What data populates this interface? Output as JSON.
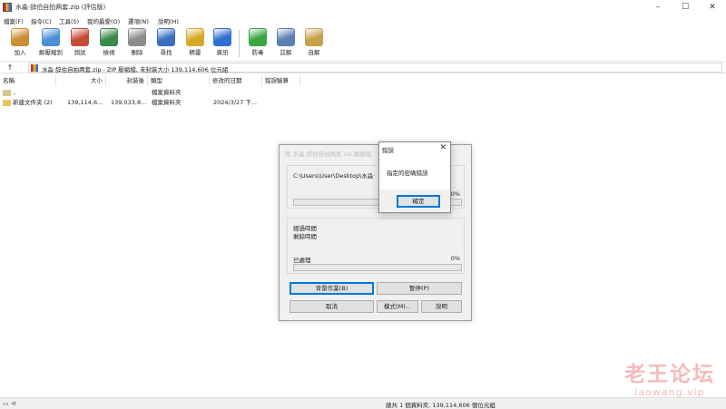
{
  "window": {
    "title": "水淼·辞伯自拍两套.zip (評估版)",
    "minimize": "–",
    "maximize": "☐",
    "close": "✕"
  },
  "menu": [
    "檔案(F)",
    "指令(C)",
    "工具(S)",
    "我的最愛(O)",
    "選項(N)",
    "說明(H)"
  ],
  "toolbar": [
    {
      "label": "加入",
      "icon": "add-archive-icon",
      "color": "#c98d35"
    },
    {
      "label": "解壓縮到",
      "icon": "extract-to-icon",
      "color": "#4d8fd6"
    },
    {
      "label": "測試",
      "icon": "test-icon",
      "color": "#c64a3a"
    },
    {
      "label": "檢視",
      "icon": "view-book-icon",
      "color": "#3b8a4a"
    },
    {
      "label": "刪除",
      "icon": "delete-bin-icon",
      "color": "#8c8c8c"
    },
    {
      "label": "尋找",
      "icon": "find-magnifier-icon",
      "color": "#3c6fc4"
    },
    {
      "label": "精靈",
      "icon": "wizard-wand-icon",
      "color": "#d6a82a"
    },
    {
      "label": "資訊",
      "icon": "info-icon",
      "color": "#2f6fd1"
    },
    {
      "label": "防毒",
      "icon": "virus-scan-icon",
      "color": "#3aa640"
    },
    {
      "label": "註解",
      "icon": "comment-icon",
      "color": "#5b7fb3"
    },
    {
      "label": "自解",
      "icon": "sfx-box-icon",
      "color": "#c8a04a"
    }
  ],
  "address": {
    "up": "↑",
    "path": "水淼·辞伯自拍两套.zip - ZIP 壓縮檔, 未封裝大小 139,114,606 位元組"
  },
  "columns": {
    "name": "名稱",
    "size": "大小",
    "packed": "封裝後",
    "type": "類型",
    "modified": "修改的日期",
    "crc": "錯誤驗算"
  },
  "rows": [
    {
      "name": "..",
      "size": "",
      "packed": "",
      "type": "檔案資料夾",
      "modified": ""
    },
    {
      "name": "新建文件夹 (2)",
      "size": "139,114,6...",
      "packed": "139,033,8...",
      "type": "檔案資料夾",
      "modified": "2024/3/27 下..."
    }
  ],
  "status": {
    "icons": "▭ ⊲",
    "text": "總共 1 個資料夾, 139,114,606 個位元組"
  },
  "progress_dialog": {
    "title": "從 水淼·辞伯自拍两套.zip 解壓縮",
    "path": "C:\\Users\\User\\Desktop\\水淼·",
    "pct_top": "0%",
    "elapsed_label": "經過時間",
    "remaining_label": "剩餘時間",
    "processed_label": "已處理",
    "pct_bottom": "0%",
    "progress_top": 0,
    "progress_bottom": 0,
    "btn_background": "背景作業(B)",
    "btn_pause": "暫停(P)",
    "btn_cancel": "取消",
    "btn_mode": "模式(M)...",
    "btn_help": "說明"
  },
  "msgbox": {
    "title": "錯誤",
    "close": "✕",
    "message": "指定的密碼錯誤",
    "ok": "確定"
  },
  "watermark": {
    "cn": "老王论坛",
    "en": "laowang.vip"
  }
}
